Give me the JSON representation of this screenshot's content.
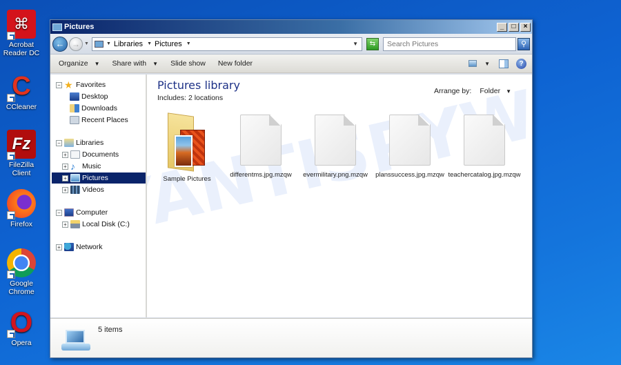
{
  "desktop": {
    "icons": [
      {
        "label": "Acrobat Reader DC",
        "icon": "acrobat-icon",
        "color": "#d4131b"
      },
      {
        "label": "CCleaner",
        "icon": "ccleaner-icon",
        "color": "#e0331f"
      },
      {
        "label": "FileZilla Client",
        "icon": "filezilla-icon",
        "color": "#b10d0d"
      },
      {
        "label": "Firefox",
        "icon": "firefox-icon",
        "color": "#ff7a18"
      },
      {
        "label": "Google Chrome",
        "icon": "chrome-icon",
        "color": "#4285f4"
      },
      {
        "label": "Opera",
        "icon": "opera-icon",
        "color": "#d0141e"
      }
    ]
  },
  "window": {
    "title": "Pictures",
    "controls": {
      "minimize": "_",
      "maximize": "□",
      "close": "×"
    }
  },
  "address": {
    "back": "←",
    "forward": "→",
    "crumbs": [
      "Libraries",
      "Pictures"
    ],
    "search_placeholder": "Search Pictures"
  },
  "commands": {
    "organize": "Organize",
    "share_with": "Share with",
    "slide_show": "Slide show",
    "new_folder": "New folder",
    "help": "?"
  },
  "navigation": {
    "favorites": {
      "label": "Favorites",
      "items": [
        "Desktop",
        "Downloads",
        "Recent Places"
      ]
    },
    "libraries": {
      "label": "Libraries",
      "items": [
        "Documents",
        "Music",
        "Pictures",
        "Videos"
      ],
      "selected": "Pictures"
    },
    "computer": {
      "label": "Computer",
      "items": [
        "Local Disk (C:)"
      ]
    },
    "network": {
      "label": "Network"
    }
  },
  "content": {
    "title": "Pictures library",
    "includes": "Includes:  2 locations",
    "arrange_label": "Arrange by:",
    "arrange_value": "Folder",
    "watermark": "MYANTISPYWARE.COM",
    "files": [
      {
        "name": "Sample Pictures",
        "type": "folder"
      },
      {
        "name": "differentms.jpg.mzqw",
        "type": "file"
      },
      {
        "name": "evermilitary.png.mzqw",
        "type": "file"
      },
      {
        "name": "planssuccess.jpg.mzqw",
        "type": "file"
      },
      {
        "name": "teachercatalog.jpg.mzqw",
        "type": "file"
      }
    ]
  },
  "status": {
    "count": "5 items"
  }
}
